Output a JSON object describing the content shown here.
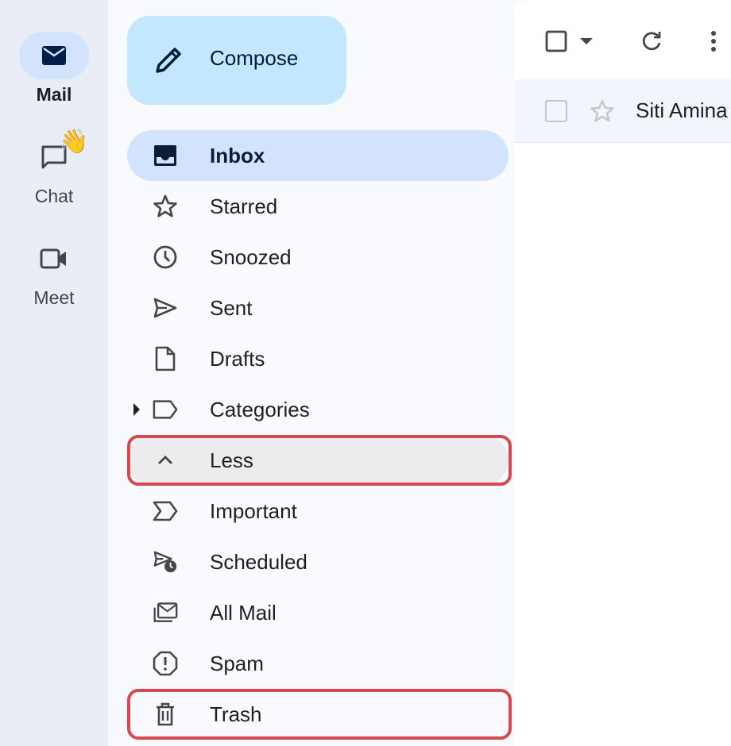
{
  "rail": {
    "items": [
      {
        "label": "Mail",
        "icon": "mail-icon"
      },
      {
        "label": "Chat",
        "icon": "chat-icon"
      },
      {
        "label": "Meet",
        "icon": "video-icon"
      }
    ],
    "chat_badge": "👋"
  },
  "compose": {
    "label": "Compose",
    "icon": "pencil-icon"
  },
  "nav": {
    "items": [
      {
        "label": "Inbox",
        "icon": "inbox-icon"
      },
      {
        "label": "Starred",
        "icon": "star-icon"
      },
      {
        "label": "Snoozed",
        "icon": "clock-icon"
      },
      {
        "label": "Sent",
        "icon": "send-icon"
      },
      {
        "label": "Drafts",
        "icon": "draft-icon"
      },
      {
        "label": "Categories",
        "icon": "label-icon"
      },
      {
        "label": "Less",
        "icon": "chevron-up-icon"
      },
      {
        "label": "Important",
        "icon": "important-icon"
      },
      {
        "label": "Scheduled",
        "icon": "scheduled-icon"
      },
      {
        "label": "All Mail",
        "icon": "all-mail-icon"
      },
      {
        "label": "Spam",
        "icon": "spam-icon"
      },
      {
        "label": "Trash",
        "icon": "trash-icon"
      }
    ]
  },
  "email_list": {
    "rows": [
      {
        "sender": "Siti Amina"
      }
    ]
  },
  "colors": {
    "rail_bg": "#e9eef6",
    "compose_bg": "#c2e7ff",
    "selected_bg": "#d3e3fd",
    "highlight_border": "#d9474f"
  }
}
